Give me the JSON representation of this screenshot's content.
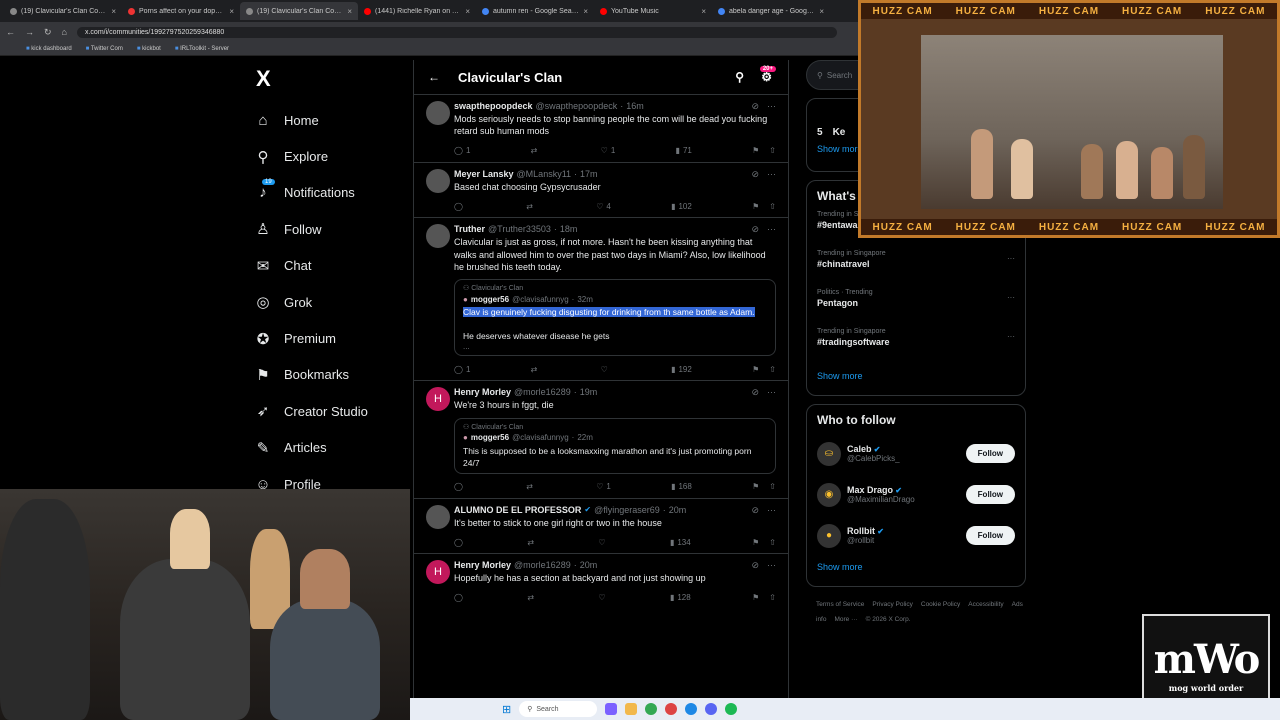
{
  "browser": {
    "tabs": [
      {
        "title": "(19) Clavicular's Clan Commu",
        "fav": "#888"
      },
      {
        "title": "Porns affect on your dopamine",
        "fav": "#e33"
      },
      {
        "title": "(19) Clavicular's Clan Commu",
        "fav": "#888",
        "active": true
      },
      {
        "title": "(1441) Richelle Ryan on The Pi",
        "fav": "#f00"
      },
      {
        "title": "autumn ren - Google Search",
        "fav": "#4285f4"
      },
      {
        "title": "YouTube Music",
        "fav": "#f00"
      },
      {
        "title": "abela danger age - Google Sea",
        "fav": "#4285f4"
      }
    ],
    "url": "x.com/i/communities/1992797520259346880",
    "bookmarks": [
      "kick dashboard",
      "Twitter Com",
      "kickbot",
      "IRLToolkit - Server"
    ]
  },
  "nav": {
    "logo": "X",
    "notifications_badge": "19",
    "items": [
      {
        "label": "Home",
        "icon": "⌂",
        "name": "home"
      },
      {
        "label": "Explore",
        "icon": "⚲",
        "name": "explore"
      },
      {
        "label": "Notifications",
        "icon": "♪",
        "name": "notifications"
      },
      {
        "label": "Follow",
        "icon": "♙",
        "name": "follow"
      },
      {
        "label": "Chat",
        "icon": "✉",
        "name": "chat"
      },
      {
        "label": "Grok",
        "icon": "◎",
        "name": "grok"
      },
      {
        "label": "Premium",
        "icon": "✪",
        "name": "premium"
      },
      {
        "label": "Bookmarks",
        "icon": "⚑",
        "name": "bookmarks"
      },
      {
        "label": "Creator Studio",
        "icon": "➶",
        "name": "creator-studio"
      },
      {
        "label": "Articles",
        "icon": "✎",
        "name": "articles"
      },
      {
        "label": "Profile",
        "icon": "☺",
        "name": "profile"
      }
    ]
  },
  "feed": {
    "title": "Clavicular's Clan",
    "badge": "20+",
    "posts": [
      {
        "name": "swapthepoopdeck",
        "handle": "@swapthepoopdeck",
        "time": "16m",
        "avatar": "",
        "text": "Mods seriously needs to stop banning people the com will be dead you fucking retard sub human mods",
        "replies": "1",
        "reposts": "",
        "likes": "1",
        "views": "71"
      },
      {
        "name": "Meyer Lansky",
        "handle": "@MLansky11",
        "time": "17m",
        "avatar": "",
        "text": "Based chat choosing Gypsycrusader",
        "replies": "",
        "reposts": "",
        "likes": "4",
        "views": "102"
      },
      {
        "name": "Truther",
        "handle": "@Truther33503",
        "time": "18m",
        "avatar": "",
        "text": "Clavicular is just as gross, if not more. Hasn't he been kissing anything that walks and allowed him to over the past two days in Miami? Also, low likelihood he brushed his teeth today.",
        "quote": {
          "community": "Clavicular's Clan",
          "name": "mogger56",
          "handle": "@clavisafunnyg",
          "time": "32m",
          "selected": "Clav is genuinely fucking disgusting for drinking from th same bottle as Adam.",
          "text": "He deserves whatever disease he gets",
          "more": "..."
        },
        "replies": "1",
        "reposts": "",
        "likes": "",
        "views": "192"
      },
      {
        "name": "Henry Morley",
        "handle": "@morle16289",
        "time": "19m",
        "avatar": "H",
        "text": "We're 3 hours in fggt, die",
        "quote": {
          "community": "Clavicular's Clan",
          "name": "mogger56",
          "handle": "@clavisafunnyg",
          "time": "22m",
          "selected": "",
          "text": "This is supposed to be a looksmaxxing marathon and it's just promoting porn 24/7",
          "more": ""
        },
        "replies": "",
        "reposts": "",
        "likes": "1",
        "views": "168"
      },
      {
        "name": "ALUMNO DE EL PROFESSOR",
        "handle": "@flyingeraser69",
        "time": "20m",
        "avatar": "",
        "verified": true,
        "text": "It's better to stick to one girl right or two in the house",
        "replies": "",
        "reposts": "",
        "likes": "",
        "views": "134"
      },
      {
        "name": "Henry Morley",
        "handle": "@morle16289",
        "time": "20m",
        "avatar": "H",
        "text": "Hopefully he has a section at backyard and not just showing up",
        "replies": "",
        "reposts": "",
        "likes": "",
        "views": "128"
      }
    ]
  },
  "right": {
    "search_placeholder": "Search",
    "top_number": "5",
    "top_partial": "Ke",
    "show_more": "Show more",
    "trends_title": "What's happening",
    "trends": [
      {
        "category": "Trending in Singapore",
        "tag": "#9entawards2026xslamparagon"
      },
      {
        "category": "Trending in Singapore",
        "tag": "#chinatravel"
      },
      {
        "category": "Politics · Trending",
        "tag": "Pentagon"
      },
      {
        "category": "Trending in Singapore",
        "tag": "#tradingsoftware"
      }
    ],
    "wtf_title": "Who to follow",
    "follow_label": "Follow",
    "who_to_follow": [
      {
        "name": "Caleb",
        "handle": "@CalebPicks_"
      },
      {
        "name": "Max Drago",
        "handle": "@MaximilianDrago"
      },
      {
        "name": "Rollbit",
        "handle": "@rollbit"
      }
    ],
    "footer": [
      "Terms of Service",
      "Privacy Policy",
      "Cookie Policy",
      "Accessibility",
      "Ads info",
      "More ···",
      "© 2026 X Corp."
    ]
  },
  "overlay": {
    "cam_banner": "HUZZ CAM",
    "logo_main": "mWo",
    "logo_sub": "mog world order"
  },
  "taskbar": {
    "search": "Search"
  }
}
